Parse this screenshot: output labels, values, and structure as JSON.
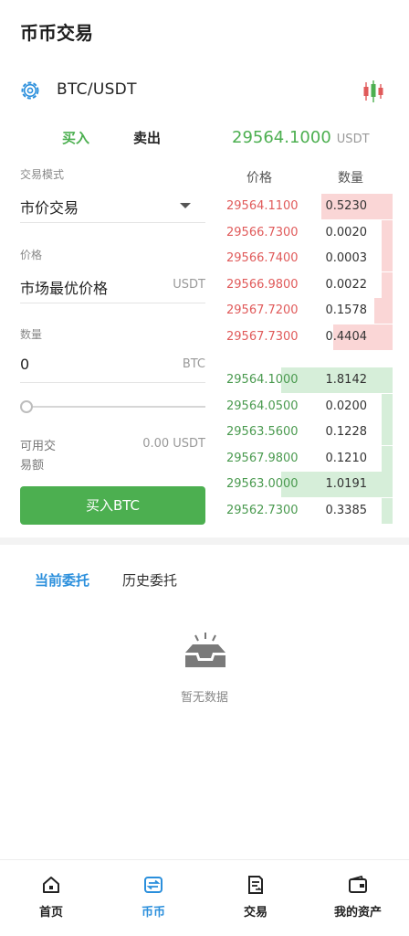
{
  "header": {
    "title": "币币交易"
  },
  "pair": {
    "symbol": "BTC/USDT",
    "kline_icon": "candlestick-icon",
    "settings_icon": "gear-icon"
  },
  "side_tabs": {
    "buy": "买入",
    "sell": "卖出"
  },
  "last_price": {
    "value": "29564.1000",
    "unit": "USDT"
  },
  "form": {
    "mode_label": "交易模式",
    "mode_value": "市价交易",
    "price_label": "价格",
    "price_value": "市场最优价格",
    "price_unit": "USDT",
    "amount_label": "数量",
    "amount_value": "0",
    "amount_unit": "BTC",
    "slider_percent": 0,
    "available_label": "可用交易额",
    "available_value": "0.00 USDT",
    "buy_button": "买入BTC"
  },
  "order_book": {
    "price_header": "价格",
    "qty_header": "数量",
    "asks": [
      {
        "price": "29564.1100",
        "qty": "0.5230",
        "depth": 0.64
      },
      {
        "price": "29566.7300",
        "qty": "0.0020",
        "depth": 0.1
      },
      {
        "price": "29566.7400",
        "qty": "0.0003",
        "depth": 0.1
      },
      {
        "price": "29566.9800",
        "qty": "0.0022",
        "depth": 0.1
      },
      {
        "price": "29567.7200",
        "qty": "0.1578",
        "depth": 0.16
      },
      {
        "price": "29567.7300",
        "qty": "0.4404",
        "depth": 0.53
      }
    ],
    "bids": [
      {
        "price": "29564.1000",
        "qty": "1.8142",
        "depth": 1.0
      },
      {
        "price": "29564.0500",
        "qty": "0.0200",
        "depth": 0.1
      },
      {
        "price": "29563.5600",
        "qty": "0.1228",
        "depth": 0.1
      },
      {
        "price": "29567.9800",
        "qty": "0.1210",
        "depth": 0.1
      },
      {
        "price": "29563.0000",
        "qty": "1.0191",
        "depth": 1.0
      },
      {
        "price": "29562.7300",
        "qty": "0.3385",
        "depth": 0.1
      }
    ]
  },
  "orders": {
    "tab_current": "当前委托",
    "tab_history": "历史委托",
    "empty_text": "暂无数据"
  },
  "tabbar": [
    {
      "label": "首页",
      "icon": "home-icon"
    },
    {
      "label": "币币",
      "icon": "exchange-icon"
    },
    {
      "label": "交易",
      "icon": "trade-document-icon"
    },
    {
      "label": "我的资产",
      "icon": "wallet-icon"
    }
  ],
  "colors": {
    "buy": "#4caf50",
    "sell": "#e05a5a",
    "accent": "#2b8fdc"
  }
}
